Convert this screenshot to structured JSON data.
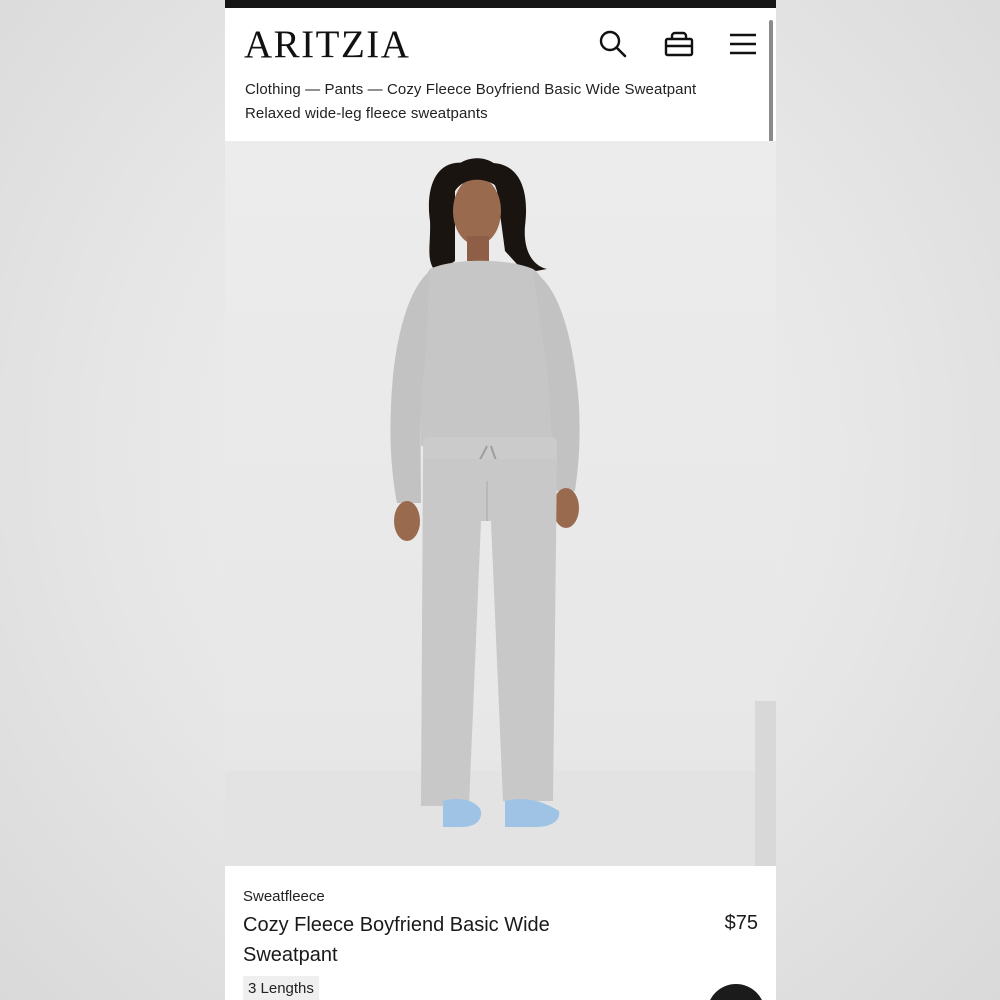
{
  "header": {
    "logo": "ARITZIA",
    "breadcrumb": "Clothing — Pants — Cozy Fleece Boyfriend Basic Wide Sweatpant",
    "subtitle": "Relaxed wide-leg fleece sweatpants",
    "icons": [
      "search-icon",
      "bag-icon",
      "menu-icon"
    ]
  },
  "product": {
    "brand": "Sweatfleece",
    "name": "Cozy Fleece Boyfriend Basic Wide Sweatpant",
    "price": "$75",
    "lengths_badge": "3 Lengths"
  },
  "colors": {
    "sweatsuit": "#c9c9c9",
    "slides": "#9ec3e4",
    "hair": "#1a1411",
    "text": "#1a1a1a"
  }
}
